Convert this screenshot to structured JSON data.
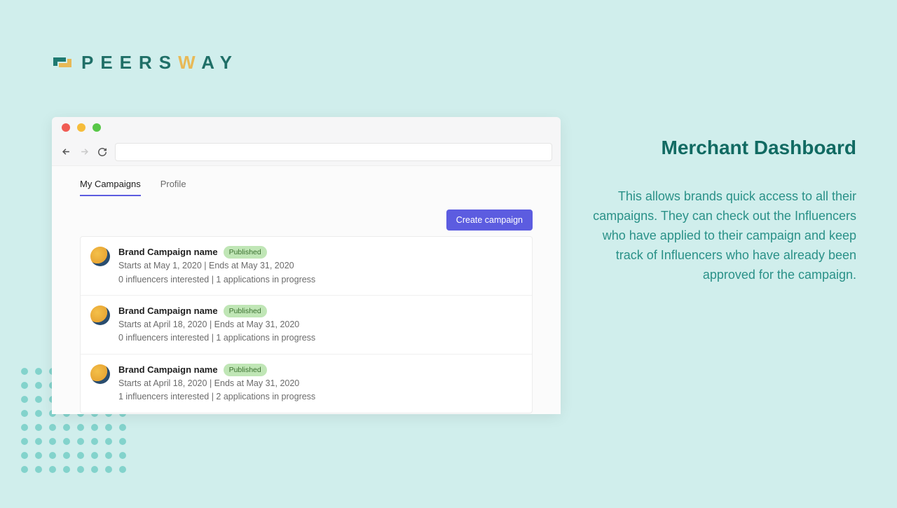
{
  "logo": {
    "text_pre": "PEERS",
    "text_w": "W",
    "text_post": "AY"
  },
  "browser": {
    "tabs": [
      {
        "label": "My Campaigns",
        "active": true
      },
      {
        "label": "Profile",
        "active": false
      }
    ],
    "create_button": "Create campaign",
    "campaigns": [
      {
        "title": "Brand Campaign name",
        "status": "Published",
        "dates": "Starts at May 1, 2020 | Ends at May 31, 2020",
        "stats": "0 influencers interested | 1 applications in progress"
      },
      {
        "title": "Brand Campaign name",
        "status": "Published",
        "dates": "Starts at April 18, 2020 | Ends at May 31, 2020",
        "stats": "0 influencers interested | 1 applications in progress"
      },
      {
        "title": "Brand Campaign name",
        "status": "Published",
        "dates": "Starts at April 18, 2020 | Ends at May 31, 2020",
        "stats": "1 influencers interested | 2 applications in progress"
      }
    ]
  },
  "side": {
    "heading": "Merchant Dashboard",
    "body": "This allows brands quick access to all their campaigns. They can check out the Influencers who have applied to their campaign and keep track of Influencers who have already been approved for the campaign."
  }
}
